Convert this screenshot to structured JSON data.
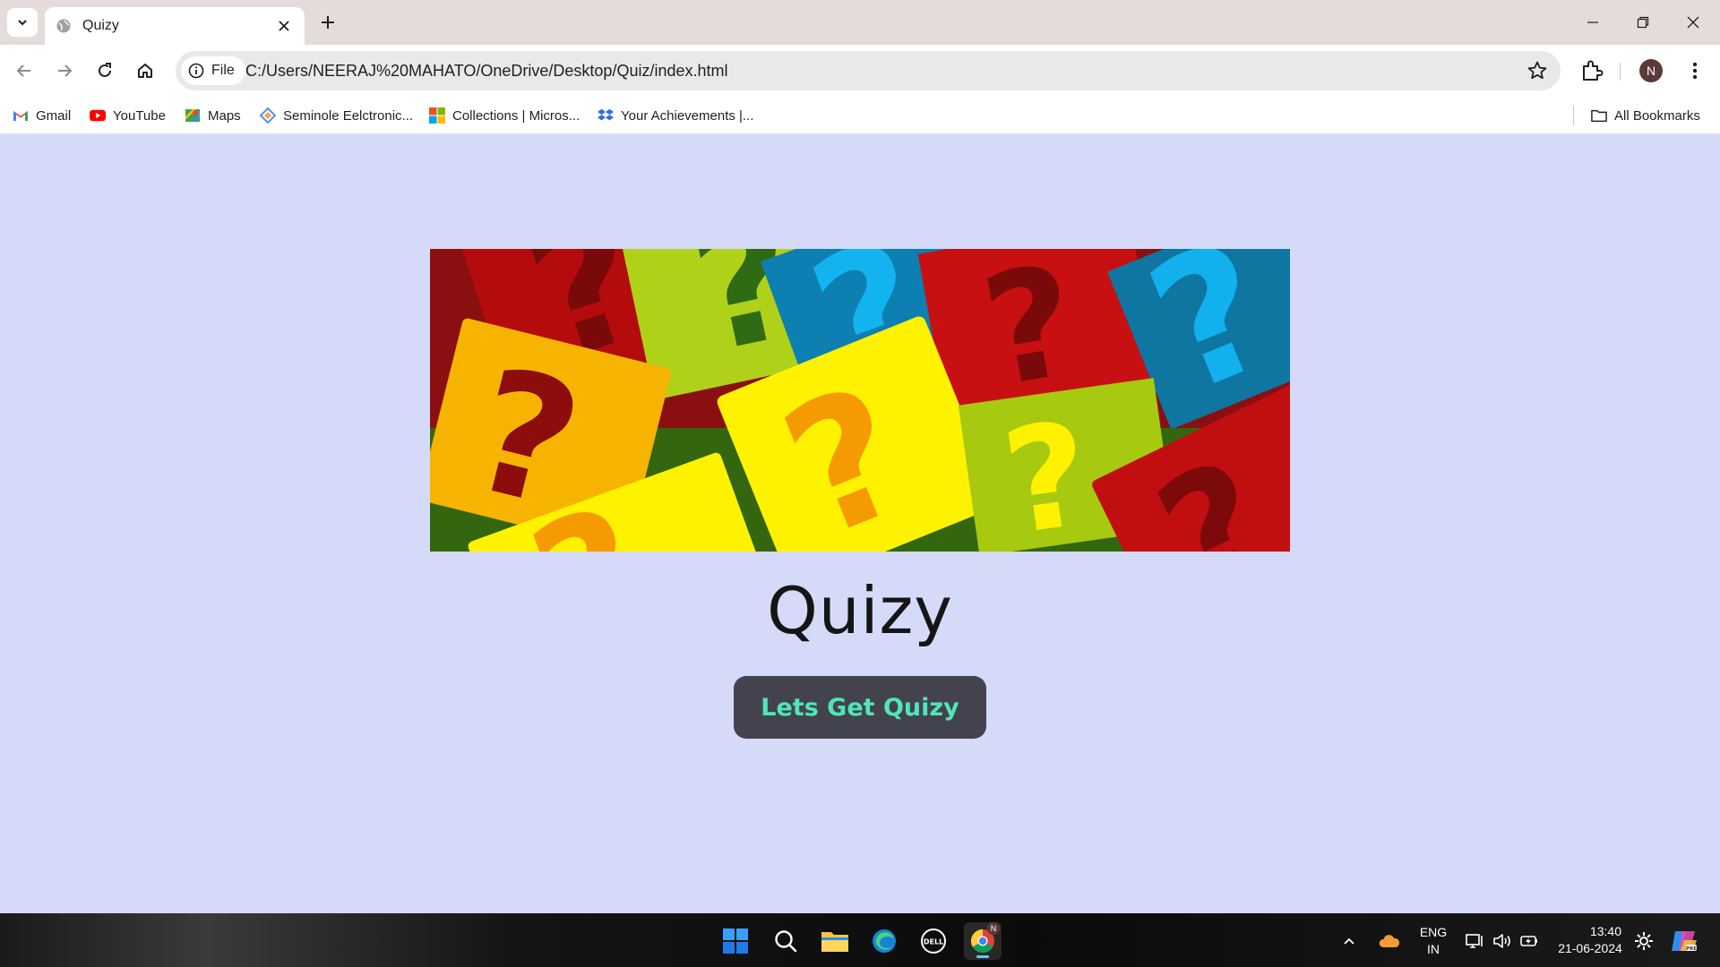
{
  "browser": {
    "tab": {
      "title": "Quizy",
      "favicon": "globe-icon"
    },
    "address": {
      "chip_label": "File",
      "url": "C:/Users/NEERAJ%20MAHATO/OneDrive/Desktop/Quiz/index.html"
    },
    "profile_initial": "N"
  },
  "bookmarks": {
    "items": [
      {
        "label": "Gmail",
        "icon": "gmail-icon"
      },
      {
        "label": "YouTube",
        "icon": "youtube-icon"
      },
      {
        "label": "Maps",
        "icon": "maps-icon"
      },
      {
        "label": "Seminole Eelctronic...",
        "icon": "diamond-icon"
      },
      {
        "label": "Collections | Micros...",
        "icon": "microsoft-icon"
      },
      {
        "label": "Your Achievements |...",
        "icon": "dropbox-icon"
      }
    ],
    "all_bookmarks": "All Bookmarks"
  },
  "page": {
    "hero_alt": "question-marks-banner",
    "title": "Quizy",
    "cta_label": "Lets Get Quizy"
  },
  "taskbar": {
    "language": "ENG",
    "region": "IN",
    "time": "13:40",
    "date": "21-06-2024",
    "chrome_badge": "N"
  },
  "colors": {
    "page_bg": "#d5daf9",
    "button_bg": "#43434f",
    "button_text": "#50e6ba"
  }
}
